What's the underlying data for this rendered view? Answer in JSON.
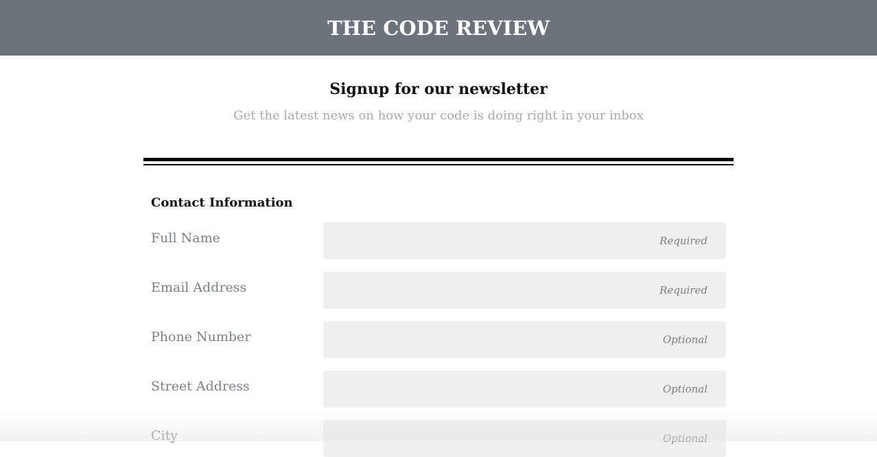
{
  "header": {
    "title": "THE CODE REVIEW",
    "background": "#6c737b"
  },
  "intro": {
    "heading": "Signup for our newsletter",
    "subheading": "Get the latest news on how your code is doing right in your inbox"
  },
  "form": {
    "section_title": "Contact Information",
    "fields": [
      {
        "label": "Full Name",
        "placeholder": "Required"
      },
      {
        "label": "Email Address",
        "placeholder": "Required"
      },
      {
        "label": "Phone Number",
        "placeholder": "Optional"
      },
      {
        "label": "Street Address",
        "placeholder": "Optional"
      },
      {
        "label": "City",
        "placeholder": "Optional"
      }
    ]
  }
}
